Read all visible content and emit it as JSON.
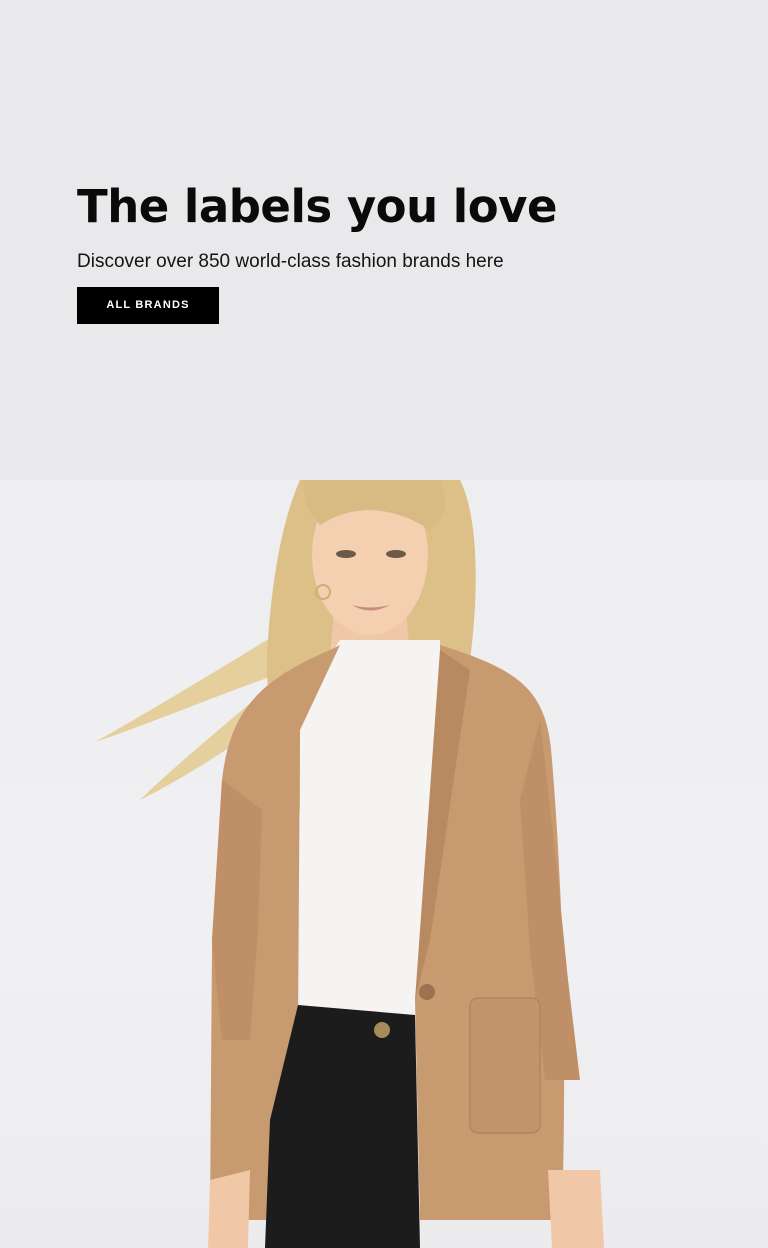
{
  "hero": {
    "headline": "The labels you love",
    "subline": "Discover over 850 world-class fashion brands here",
    "cta_label": "ALL BRANDS"
  },
  "colors": {
    "background": "#e9e9eb",
    "button": "#000000",
    "button_text": "#ffffff",
    "jacket": "#c89a70"
  }
}
